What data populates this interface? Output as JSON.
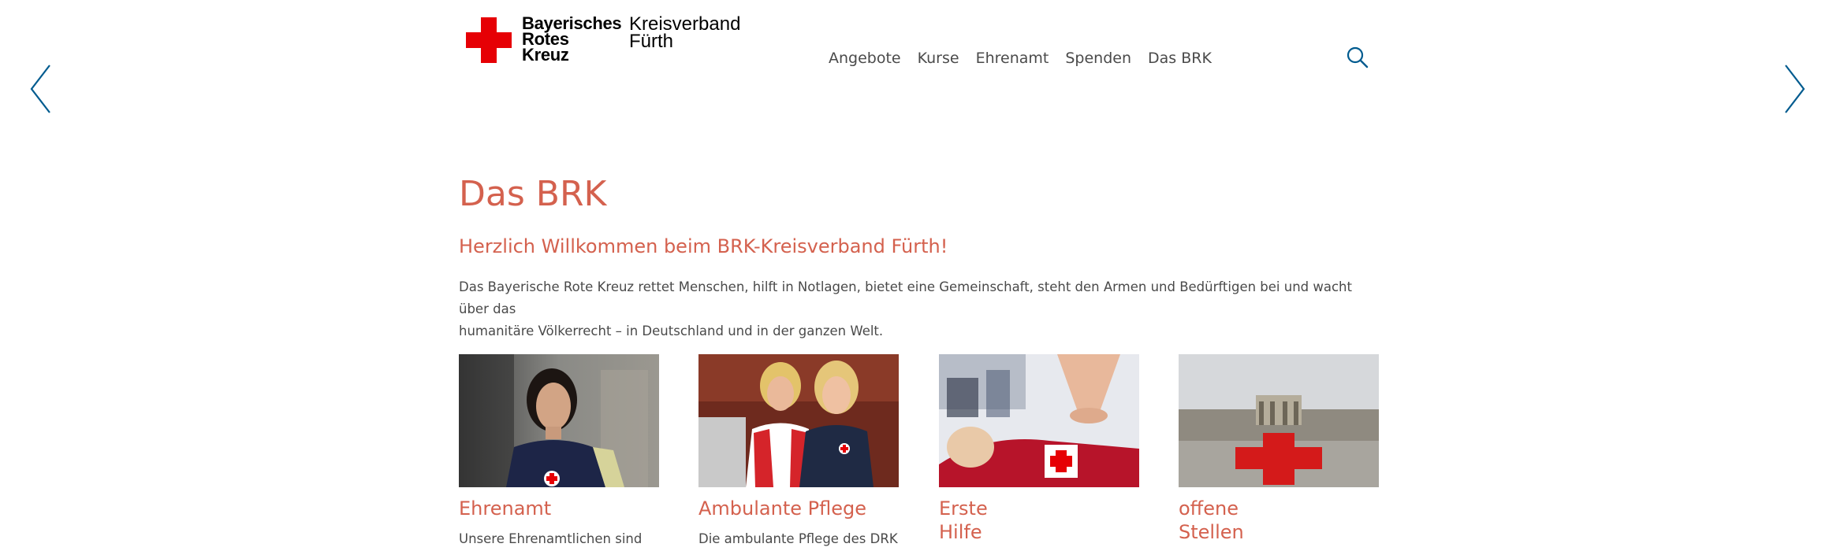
{
  "colors": {
    "accent": "#d4614e",
    "link_blue": "#005b8f",
    "brk_red": "#e60005"
  },
  "header": {
    "logo": {
      "line1": "Bayerisches",
      "line2": "Rotes",
      "line3": "Kreuz"
    },
    "kreisverband": {
      "line1": "Kreisverband",
      "line2": "Fürth"
    },
    "nav": [
      "Angebote",
      "Kurse",
      "Ehrenamt",
      "Spenden",
      "Das BRK"
    ],
    "search_icon": "search-icon"
  },
  "carousel": {
    "prev_icon": "chevron-left-icon",
    "next_icon": "chevron-right-icon"
  },
  "main": {
    "title": "Das BRK",
    "subtitle": "Herzlich Willkommen beim BRK-Kreisverband Fürth!",
    "intro_line1": "Das Bayerische Rote Kreuz rettet Menschen, hilft in Notlagen, bietet eine Gemeinschaft, steht den Armen und Bedürftigen bei und wacht über das",
    "intro_line2": "humanitäre Völkerrecht – in Deutschland und in der ganzen Welt."
  },
  "cards": [
    {
      "title": "Ehrenamt",
      "text": "Unsere Ehrenamtlichen sind"
    },
    {
      "title": "Ambulante Pflege",
      "text": "Die ambulante Pflege des DRK"
    },
    {
      "title_line1": "Erste",
      "title_line2": "Hilfe"
    },
    {
      "title_line1": "offene",
      "title_line2": "Stellen"
    }
  ]
}
